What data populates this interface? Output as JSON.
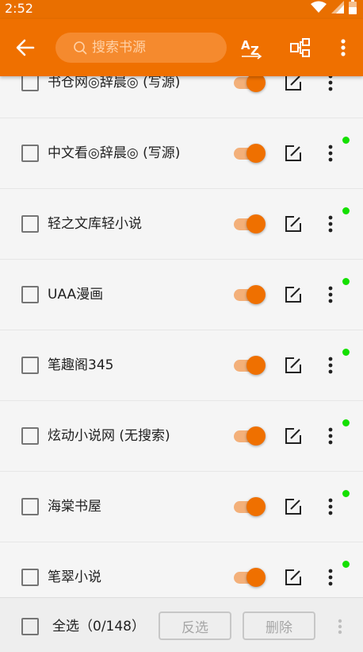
{
  "status_bar": {
    "time": "2:52",
    "icons": [
      "wifi-icon",
      "signal-icon",
      "battery-icon"
    ]
  },
  "toolbar": {
    "back_icon": "arrow-left-icon",
    "search_placeholder": "搜索书源",
    "sort_icon": "sort-az-icon",
    "group_icon": "group-icon",
    "menu_icon": "more-vert-icon"
  },
  "sources": [
    {
      "name": "书仓网◎辞晨◎ (写源)",
      "enabled": true,
      "selected": false,
      "has_dot": false
    },
    {
      "name": "中文看◎辞晨◎ (写源)",
      "enabled": true,
      "selected": false,
      "has_dot": true
    },
    {
      "name": "轻之文库轻小说",
      "enabled": true,
      "selected": false,
      "has_dot": true
    },
    {
      "name": "UAA漫画",
      "enabled": true,
      "selected": false,
      "has_dot": true
    },
    {
      "name": "笔趣阁345",
      "enabled": true,
      "selected": false,
      "has_dot": true
    },
    {
      "name": "炫动小说网 (无搜索)",
      "enabled": true,
      "selected": false,
      "has_dot": true
    },
    {
      "name": "海棠书屋",
      "enabled": true,
      "selected": false,
      "has_dot": true
    },
    {
      "name": "笔翠小说",
      "enabled": true,
      "selected": false,
      "has_dot": true
    }
  ],
  "bottom_bar": {
    "select_all_label": "全选（0/148）",
    "invert_label": "反选",
    "delete_label": "删除"
  },
  "colors": {
    "accent": "#ef7000",
    "switch_track": "#f3b07a",
    "status_dot": "#14e000"
  }
}
